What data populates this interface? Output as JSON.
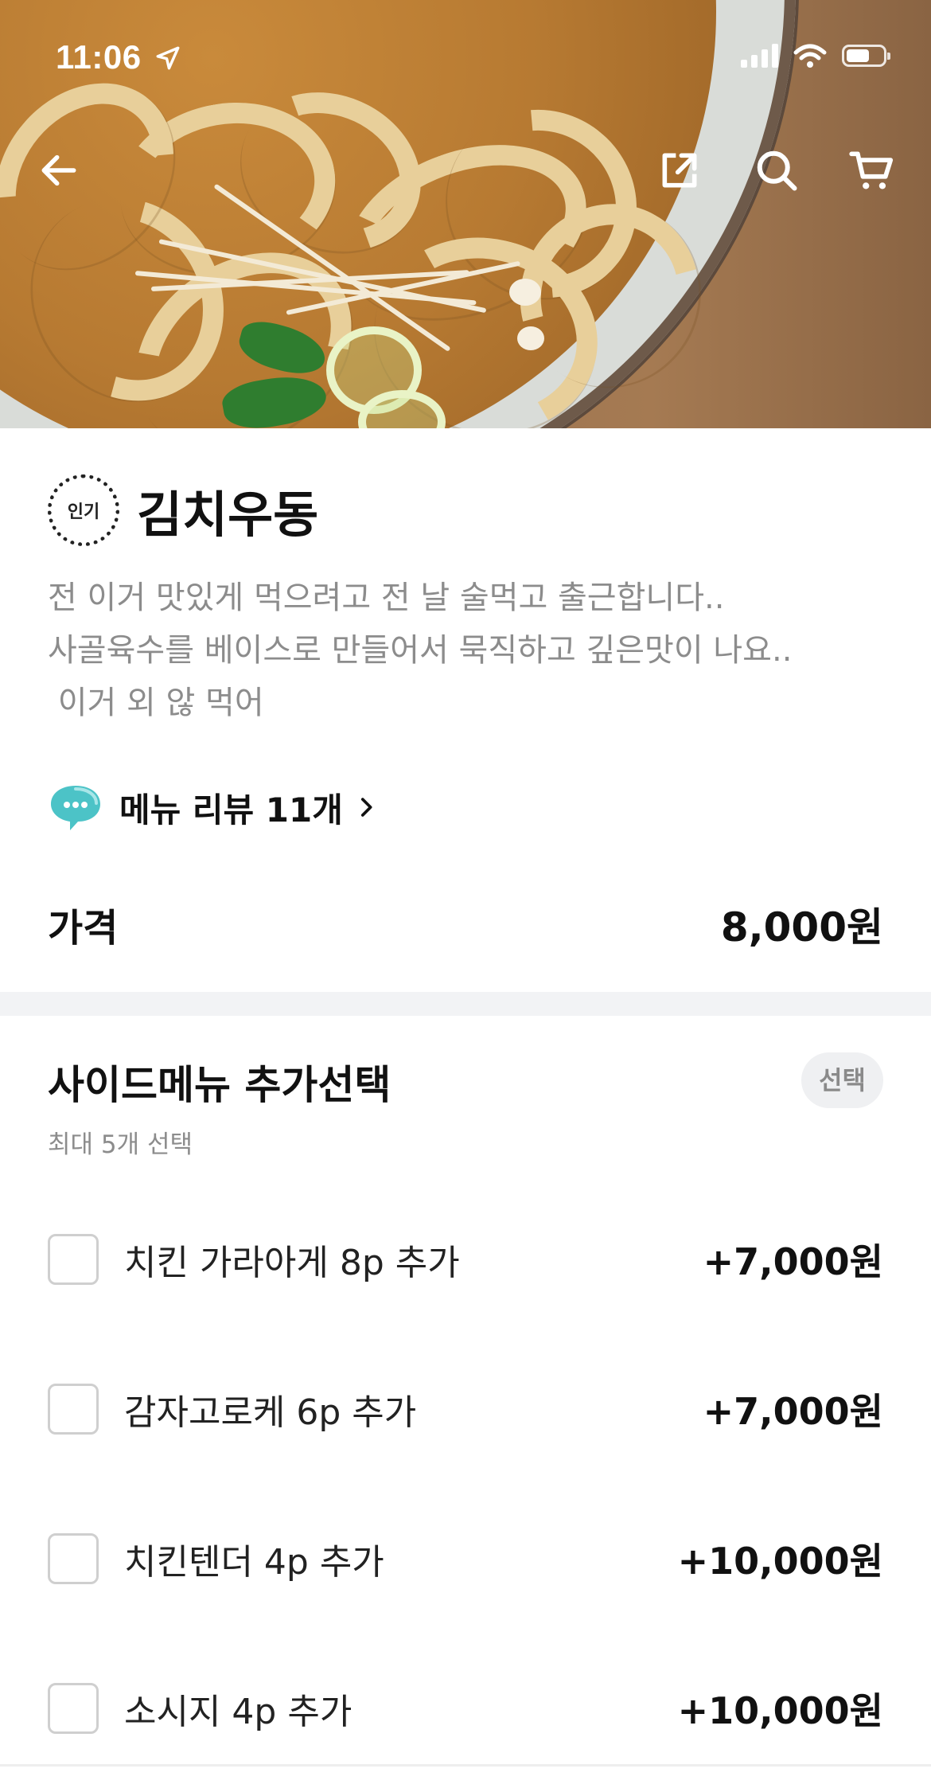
{
  "status_bar": {
    "time": "11:06"
  },
  "nav": {
    "back_icon": "arrow-left-icon",
    "share_icon": "share-icon",
    "search_icon": "search-icon",
    "cart_icon": "cart-icon"
  },
  "menu": {
    "badge": "인기",
    "title": "김치우동",
    "description_lines": [
      "전 이거 맛있게 먹으려고 전 날 술먹고 출근합니다..",
      "사골육수를 베이스로 만들어서 묵직하고 깊은맛이 나요..",
      " 이거 외 않 먹어"
    ],
    "review_link": "메뉴 리뷰 11개",
    "price_label": "가격",
    "price_value": "8,000원"
  },
  "options": {
    "title": "사이드메뉴 추가선택",
    "badge": "선택",
    "subtitle": "최대 5개 선택",
    "items": [
      {
        "name": "치킨 가라아게 8p 추가",
        "price": "+7,000원"
      },
      {
        "name": "감자고로케 6p 추가",
        "price": "+7,000원"
      },
      {
        "name": "치킨텐더 4p 추가",
        "price": "+10,000원"
      },
      {
        "name": "소시지 4p 추가",
        "price": "+10,000원"
      }
    ]
  },
  "colors": {
    "text_primary": "#111111",
    "text_secondary": "#8c8c8c",
    "checkbox_border": "#cfcfcf",
    "chat_icon": "#4cc3c7"
  }
}
